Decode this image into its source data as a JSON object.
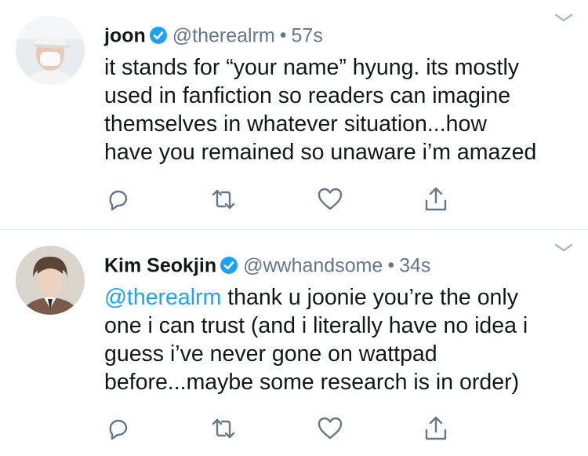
{
  "tweets": [
    {
      "name": "joon",
      "handle": "@therealrm",
      "separator": "•",
      "time": "57s",
      "text_lines": [
        "it stands for “your name” hyung. its mostly",
        "used in fanfiction so readers can imagine",
        "themselves in whatever situation...how",
        "have you remained so unaware i’m amazed"
      ],
      "avatar": "avatar-person-mask-cap"
    },
    {
      "name": "Kim Seokjin",
      "handle": "@wwhandsome",
      "separator": "•",
      "time": "34s",
      "mention": "@therealrm",
      "first_line_rest": " thank u joonie you’re the only",
      "text_lines": [
        "one i can trust (and i literally have no idea i",
        "guess i’ve never gone on wattpad",
        "before...maybe some research is in order)"
      ],
      "avatar": "avatar-person-suit"
    }
  ],
  "icons": {
    "reply": "reply-icon",
    "retweet": "retweet-icon",
    "like": "heart-icon",
    "share": "share-icon",
    "verified": "verified-badge-icon",
    "menu": "chevron-down-icon"
  },
  "colors": {
    "text": "#14171a",
    "secondary": "#657786",
    "link": "#1da1f2",
    "verified": "#1da1f2",
    "divider": "#e1e8ed",
    "icon": "#657786"
  }
}
